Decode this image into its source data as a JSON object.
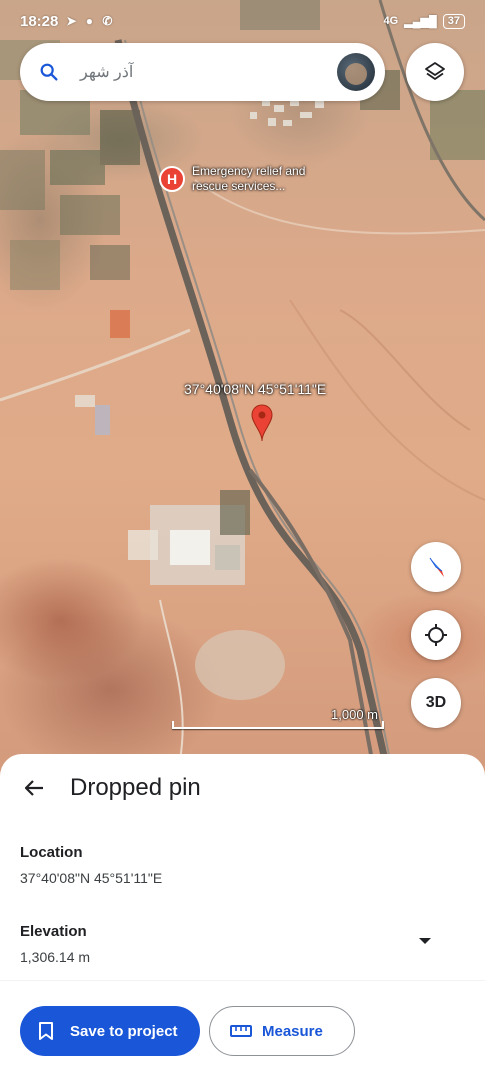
{
  "status_bar": {
    "time": "18:28",
    "network": "4G",
    "battery": "37"
  },
  "search": {
    "query": "آذر شهر"
  },
  "map": {
    "poi_icon_letter": "H",
    "poi_label": "Emergency relief and rescue services...",
    "pin_coordinates": "37°40'08\"N 45°51'11\"E",
    "scale_label": "1,000 m",
    "btn_3d": "3D"
  },
  "sheet": {
    "title": "Dropped pin",
    "location_label": "Location",
    "location_value": "37°40'08\"N 45°51'11\"E",
    "elevation_label": "Elevation",
    "elevation_value": "1,306.14 m"
  },
  "actions": {
    "save_label": "Save to project",
    "measure_label": "Measure"
  },
  "colors": {
    "primary": "#1a57d8",
    "pin": "#ea4335"
  },
  "icons": [
    "search-icon",
    "layers-icon",
    "compass-icon",
    "my-location-icon",
    "back-arrow-icon",
    "chevron-down-icon",
    "bookmark-icon",
    "ruler-icon",
    "map-pin-icon"
  ]
}
